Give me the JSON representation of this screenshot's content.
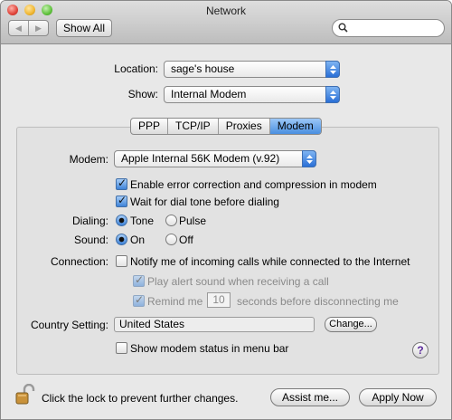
{
  "window": {
    "title": "Network"
  },
  "toolbar": {
    "back_icon": "back-arrow-icon",
    "forward_icon": "forward-arrow-icon",
    "show_all_label": "Show All",
    "search_placeholder": ""
  },
  "location": {
    "label": "Location:",
    "value": "sage's house"
  },
  "show": {
    "label": "Show:",
    "value": "Internal Modem"
  },
  "tabs": [
    {
      "label": "PPP",
      "active": false
    },
    {
      "label": "TCP/IP",
      "active": false
    },
    {
      "label": "Proxies",
      "active": false
    },
    {
      "label": "Modem",
      "active": true
    }
  ],
  "modem": {
    "label": "Modem:",
    "value": "Apple Internal 56K Modem (v.92)"
  },
  "options": {
    "error_correction": {
      "label": "Enable error correction and compression in modem",
      "checked": true
    },
    "dial_tone": {
      "label": "Wait for dial tone before dialing",
      "checked": true
    }
  },
  "dialing": {
    "label": "Dialing:",
    "options": [
      "Tone",
      "Pulse"
    ],
    "selected": "Tone"
  },
  "sound": {
    "label": "Sound:",
    "options": [
      "On",
      "Off"
    ],
    "selected": "On"
  },
  "connection": {
    "label": "Connection:",
    "notify": {
      "label": "Notify me of incoming calls while connected to the Internet",
      "checked": false
    },
    "play_alert": {
      "label": "Play alert sound when receiving a call",
      "checked": true,
      "enabled": false
    },
    "remind": {
      "label_before": "Remind me",
      "value": "10",
      "label_after": "seconds before disconnecting me",
      "checked": true,
      "enabled": false
    }
  },
  "country": {
    "label": "Country Setting:",
    "value": "United States",
    "change_label": "Change..."
  },
  "menu_bar": {
    "label": "Show modem status in menu bar",
    "checked": false
  },
  "help": {
    "label": "?"
  },
  "footer": {
    "lock_text": "Click the lock to prevent further changes.",
    "assist_label": "Assist me...",
    "apply_label": "Apply Now"
  },
  "colors": {
    "accent": "#3d82d8",
    "window_bg": "#e8e8e8",
    "panel_bg": "#e2e2e2"
  }
}
